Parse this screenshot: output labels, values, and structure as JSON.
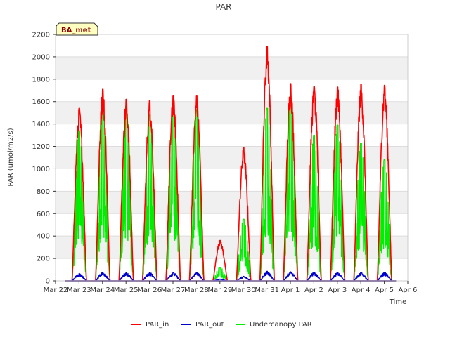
{
  "chart_data": {
    "type": "line",
    "title": "PAR",
    "xlabel": "Time",
    "ylabel": "PAR (umol/m2/s)",
    "badge": "BA_met",
    "ylim": [
      0,
      2200
    ],
    "yticks": [
      0,
      200,
      400,
      600,
      800,
      1000,
      1200,
      1400,
      1600,
      1800,
      2000,
      2200
    ],
    "xlim": [
      0,
      15
    ],
    "xtick_labels": [
      "Mar 22",
      "Mar 23",
      "Mar 24",
      "Mar 25",
      "Mar 26",
      "Mar 27",
      "Mar 28",
      "Mar 29",
      "Mar 30",
      "Mar 31",
      "Apr 1",
      "Apr 2",
      "Apr 3",
      "Apr 4",
      "Apr 5",
      "Apr 6"
    ],
    "grid": true,
    "legend_position": "bottom",
    "series": [
      {
        "name": "PAR_in",
        "color": "#ff0000",
        "days": [
          "Mar 23",
          "Mar 24",
          "Mar 25",
          "Mar 26",
          "Mar 27",
          "Mar 28",
          "Mar 29",
          "Mar 30",
          "Mar 31",
          "Apr 1",
          "Apr 2",
          "Apr 3",
          "Apr 4",
          "Apr 5"
        ],
        "daily_peak": [
          1540,
          1710,
          1620,
          1610,
          1650,
          1650,
          360,
          1190,
          2090,
          1760,
          1735,
          1730,
          1755,
          1745
        ]
      },
      {
        "name": "PAR_out",
        "color": "#0000cc",
        "days": [
          "Mar 23",
          "Mar 24",
          "Mar 25",
          "Mar 26",
          "Mar 27",
          "Mar 28",
          "Mar 29",
          "Mar 30",
          "Mar 31",
          "Apr 1",
          "Apr 2",
          "Apr 3",
          "Apr 4",
          "Apr 5"
        ],
        "daily_peak": [
          65,
          75,
          75,
          75,
          75,
          75,
          15,
          40,
          85,
          80,
          75,
          75,
          75,
          75
        ]
      },
      {
        "name": "Undercanopy PAR",
        "color": "#00ee00",
        "days": [
          "Mar 23",
          "Mar 24",
          "Mar 25",
          "Mar 26",
          "Mar 27",
          "Mar 28",
          "Mar 29",
          "Mar 30",
          "Mar 31",
          "Apr 1",
          "Apr 2",
          "Apr 3",
          "Apr 4",
          "Apr 5"
        ],
        "daily_peak": [
          1340,
          1570,
          1560,
          1480,
          1510,
          1530,
          120,
          550,
          1540,
          1650,
          1300,
          1390,
          1230,
          1080
        ]
      }
    ]
  }
}
